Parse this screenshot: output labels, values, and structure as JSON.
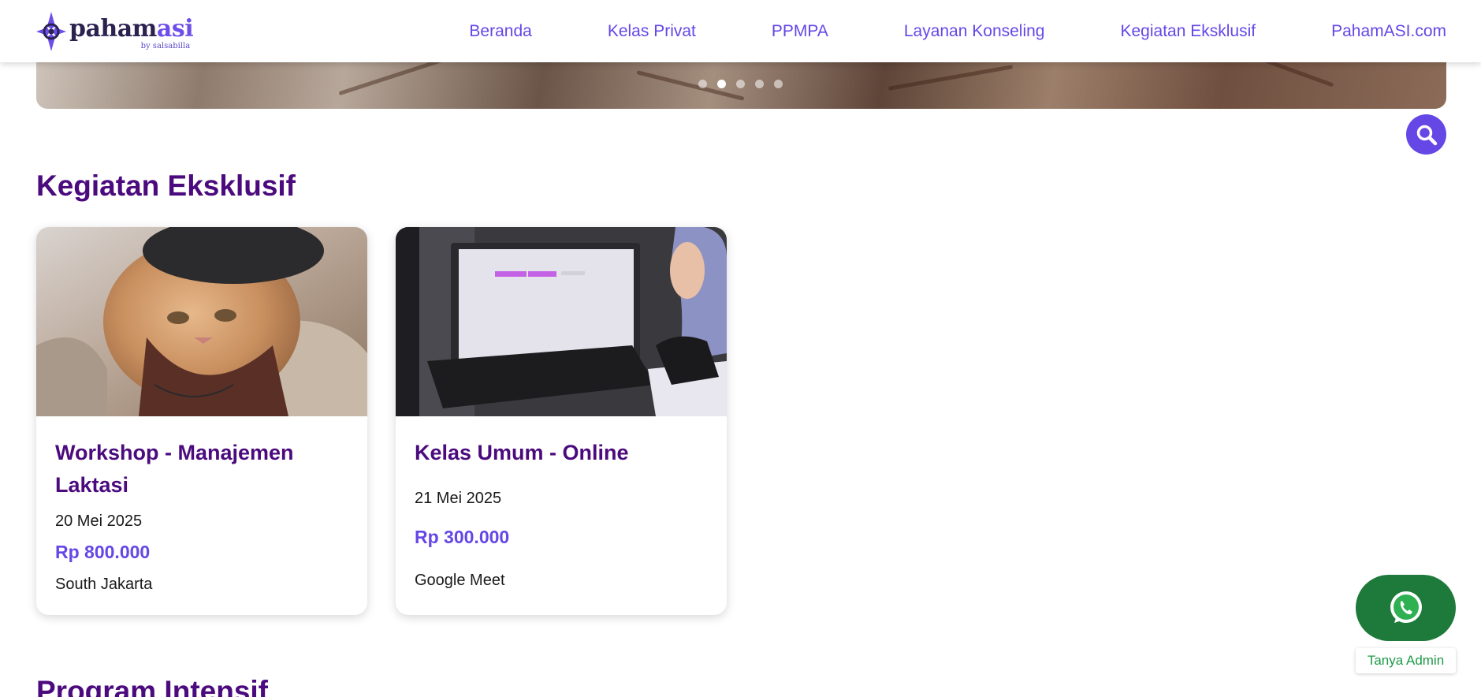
{
  "logo": {
    "word_a": "paham",
    "word_b": "asi",
    "sub": "by salsabilla"
  },
  "nav": {
    "items": [
      "Beranda",
      "Kelas Privat",
      "PPMPA",
      "Layanan Konseling",
      "Kegiatan Eksklusif",
      "PahamASI.com"
    ]
  },
  "carousel": {
    "slide_count": 5,
    "active_index": 1
  },
  "sections": {
    "exclusive_title": "Kegiatan Eksklusif",
    "intensive_title": "Program Intensif"
  },
  "events": [
    {
      "title": "Workshop - Manajemen Laktasi",
      "date": "20 Mei 2025",
      "price": "Rp 800.000",
      "location": "South Jakarta",
      "image": "cat-photo"
    },
    {
      "title": "Kelas Umum - Online",
      "date": "21 Mei 2025",
      "price": "Rp 300.000",
      "location": "Google Meet",
      "image": "woman-at-computer-photo"
    }
  ],
  "whatsapp": {
    "label": "Tanya Admin",
    "icon": "whatsapp-icon"
  },
  "colors": {
    "accent": "#6547e6",
    "heading": "#4b0a7d",
    "whatsapp": "#1e7a3a"
  }
}
